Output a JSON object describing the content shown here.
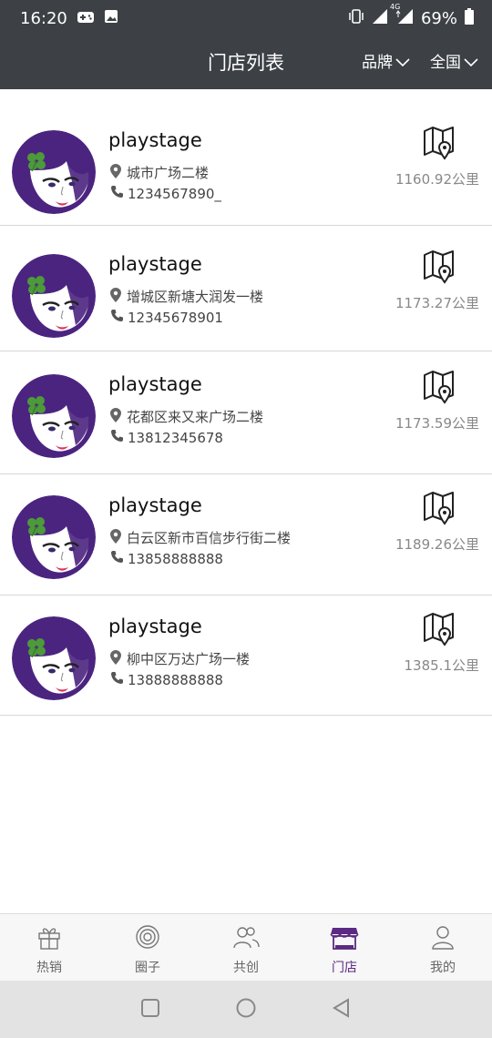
{
  "status_bar": {
    "time": "16:20",
    "battery": "69%",
    "network": "4G",
    "icons": [
      "game-icon",
      "image-icon",
      "vibrate-icon",
      "signal-icon",
      "battery-icon"
    ]
  },
  "header": {
    "title": "门店列表",
    "brand_filter": "品牌",
    "region_filter": "全国",
    "background": "#3d4045"
  },
  "stores": [
    {
      "name": "playstage",
      "address": "城市广场二楼",
      "phone": "1234567890_",
      "distance": "1160.92公里"
    },
    {
      "name": "playstage",
      "address": "增城区新塘大润发一楼",
      "phone": "12345678901",
      "distance": "1173.27公里"
    },
    {
      "name": "playstage",
      "address": "花都区来又来广场二楼",
      "phone": "13812345678",
      "distance": "1173.59公里"
    },
    {
      "name": "playstage",
      "address": "白云区新市百信步行街二楼",
      "phone": "13858888888",
      "distance": "1189.26公里"
    },
    {
      "name": "playstage",
      "address": "柳中区万达广场一楼",
      "phone": "13888888888",
      "distance": "1385.1公里"
    }
  ],
  "tabs": [
    {
      "label": "热销",
      "icon": "gift-icon"
    },
    {
      "label": "圈子",
      "icon": "circle-icon"
    },
    {
      "label": "共创",
      "icon": "people-icon"
    },
    {
      "label": "门店",
      "icon": "store-icon",
      "active": true
    },
    {
      "label": "我的",
      "icon": "person-icon"
    }
  ],
  "colors": {
    "accent": "#5b2a82",
    "avatar_purple": "#4b2480",
    "leaf_green": "#4c9a3a"
  }
}
